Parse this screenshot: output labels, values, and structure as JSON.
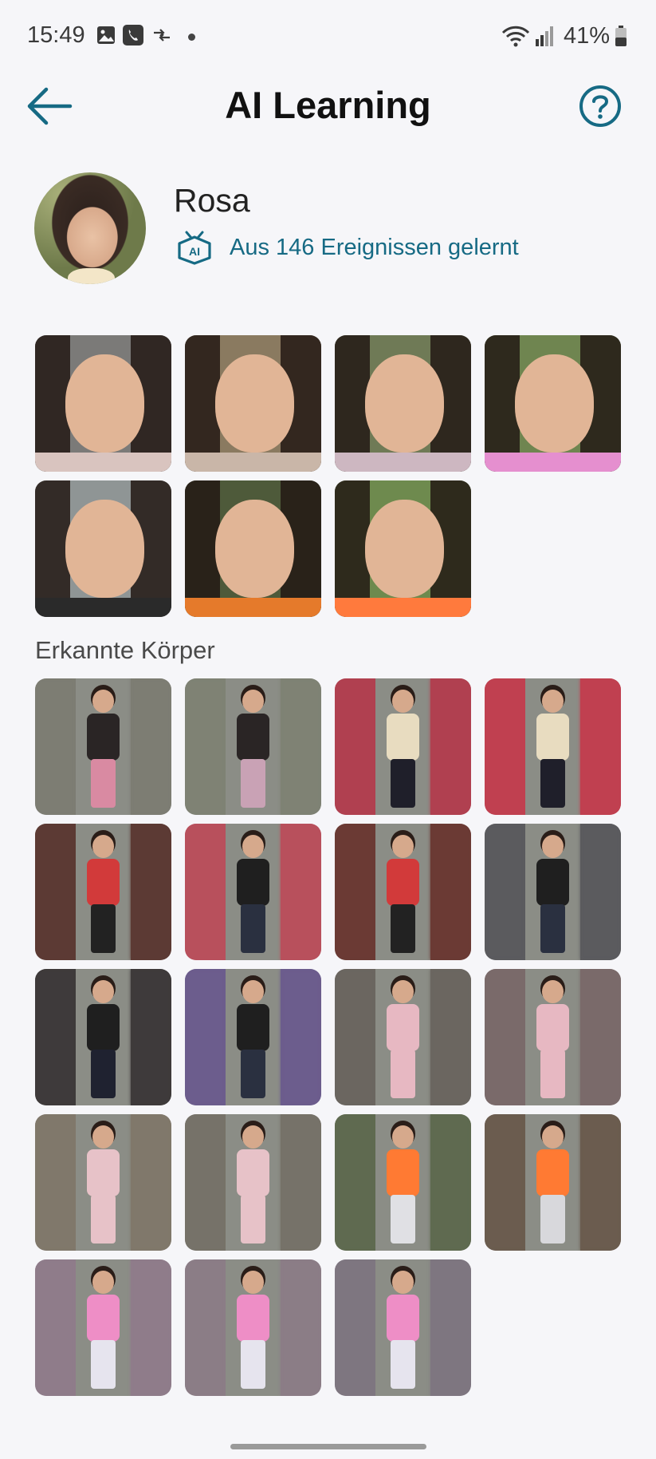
{
  "status_bar": {
    "time": "15:49",
    "battery": "41%",
    "icons": [
      "gallery-icon",
      "phone-call-icon",
      "data-transfer-icon",
      "notification-dot-icon",
      "wifi-icon",
      "signal-icon",
      "battery-icon"
    ]
  },
  "header": {
    "title": "AI Learning",
    "back_icon": "arrow-left-icon",
    "help_icon": "help-circle-icon"
  },
  "profile": {
    "name": "Rosa",
    "learned_text": "Aus 146 Ereignissen gelernt",
    "ai_icon": "ai-robot-icon"
  },
  "colors": {
    "accent": "#166a84",
    "background": "#f6f6f9",
    "title": "#111111"
  },
  "faces": [
    {
      "label": "face-1",
      "bg": "#7b7a78",
      "shirt": "#d9c4bf"
    },
    {
      "label": "face-2",
      "bg": "#8a7a60",
      "shirt": "#c9b6a8"
    },
    {
      "label": "face-3",
      "bg": "#6f7a56",
      "shirt": "#cdb7c1"
    },
    {
      "label": "face-4",
      "bg": "#6f8550",
      "shirt": "#e58fcf"
    },
    {
      "label": "face-5",
      "bg": "#8f9595",
      "shirt": "#2a2a2a"
    },
    {
      "label": "face-6",
      "bg": "#4e5a3a",
      "shirt": "#e57a2b"
    },
    {
      "label": "face-7",
      "bg": "#6e8a4e",
      "shirt": "#ff7a3d"
    }
  ],
  "bodies_section_title": "Erkannte Körper",
  "bodies": [
    {
      "blur": "#7d7d73",
      "torso": "#2a2525",
      "legs": "#d98aa2"
    },
    {
      "blur": "#7f8274",
      "torso": "#2a2525",
      "legs": "#c9a2b5"
    },
    {
      "blur": "#b04050",
      "torso": "#e8dcc0",
      "legs": "#1f1f2a"
    },
    {
      "blur": "#c04050",
      "torso": "#e8dcc0",
      "legs": "#1f1f2a"
    },
    {
      "blur": "#5c3a34",
      "torso": "#d23a3a",
      "legs": "#222222"
    },
    {
      "blur": "#b8505c",
      "torso": "#1f1f1f",
      "legs": "#2a3040"
    },
    {
      "blur": "#6b3a34",
      "torso": "#d23a3a",
      "legs": "#222222"
    },
    {
      "blur": "#5b5b5e",
      "torso": "#1f1f1f",
      "legs": "#2a3040"
    },
    {
      "blur": "#3e3a3b",
      "torso": "#1f1f1f",
      "legs": "#1f2230"
    },
    {
      "blur": "#6c5d8d",
      "torso": "#1f1f1f",
      "legs": "#2a3040"
    },
    {
      "blur": "#6b6660",
      "torso": "#e7b8c2",
      "legs": "#e7b8c2"
    },
    {
      "blur": "#7a6a6a",
      "torso": "#e7b8c2",
      "legs": "#e7b8c2"
    },
    {
      "blur": "#80786b",
      "torso": "#e7c2c8",
      "legs": "#e7c2c8"
    },
    {
      "blur": "#767269",
      "torso": "#e7c2c8",
      "legs": "#e7c2c8"
    },
    {
      "blur": "#5f6a50",
      "torso": "#ff7a33",
      "legs": "#e0e0e4"
    },
    {
      "blur": "#6b5c4f",
      "torso": "#ff7a33",
      "legs": "#d8d8dc"
    },
    {
      "blur": "#8f7c8a",
      "torso": "#ee8ec6",
      "legs": "#e6e4ee"
    },
    {
      "blur": "#8b7d86",
      "torso": "#ee8ec6",
      "legs": "#e6e4ee"
    },
    {
      "blur": "#7e7680",
      "torso": "#ee8ec6",
      "legs": "#e6e4ee"
    }
  ]
}
